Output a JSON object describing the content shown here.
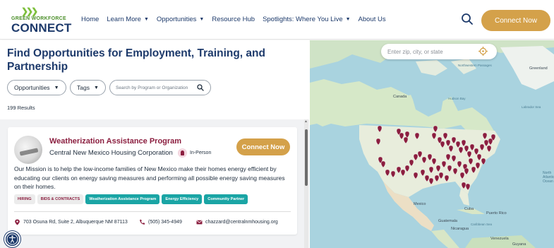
{
  "header": {
    "logo_small": "GREEN WORKFORCE",
    "logo_big": "CONNECT",
    "nav": [
      {
        "label": "Home",
        "caret": false
      },
      {
        "label": "Learn More",
        "caret": true
      },
      {
        "label": "Opportunities",
        "caret": true
      },
      {
        "label": "Resource Hub",
        "caret": false
      },
      {
        "label": "Spotlights: Where You Live",
        "caret": true
      },
      {
        "label": "About Us",
        "caret": false
      }
    ],
    "connect_label": "Connect Now"
  },
  "main": {
    "title": "Find Opportunities for Employment, Training, and Partnership",
    "filters": {
      "opportunities": "Opportunities",
      "tags": "Tags"
    },
    "search_placeholder": "Search by Program or Organization",
    "results": "199 Results"
  },
  "card": {
    "title": "Weatherization Assistance Program",
    "org": "Central New Mexico Housing Corporation",
    "mode": "In-Person",
    "connect_label": "Connect Now",
    "description": "Our Mission is to help the low-income families of New Mexico make their homes energy efficient by educating our clients on energy saving measures and performing all possible energy saving measures on their homes.",
    "tags_gray": [
      "HIRING",
      "BIDS & CONTRACTS"
    ],
    "tags_teal": [
      "Weatherization Assistance Program",
      "Energy Efficiency",
      "Community Partner"
    ],
    "address": "703 Osuna Rd, Suite 2, Albuquerque NM 87113",
    "phone": "(505) 345-4949",
    "email": "chazzard@centralnmhousing.org"
  },
  "map": {
    "search_placeholder": "Enter zip, city, or state",
    "labels": {
      "canada": "Canada",
      "greenland": "Greenland",
      "nw_passages": "Northwestern Passages",
      "hudson_bay": "Hudson Bay",
      "labrador_sea": "Labrador Sea",
      "north_atlantic": "North Atlantic Ocean",
      "mexico": "Mexico",
      "cuba": "Cuba",
      "puerto_rico": "Puerto Rico",
      "guatemala": "Guatemala",
      "nicaragua": "Nicaragua",
      "caribbean_sea": "Caribbean Sea",
      "venezuela": "Venezuela",
      "guyana": "Guyana"
    }
  },
  "colors": {
    "brand_navy": "#1d3a6b",
    "brand_gold": "#d4a14a",
    "maroon": "#8b1e3f",
    "teal": "#1aa5a5"
  }
}
